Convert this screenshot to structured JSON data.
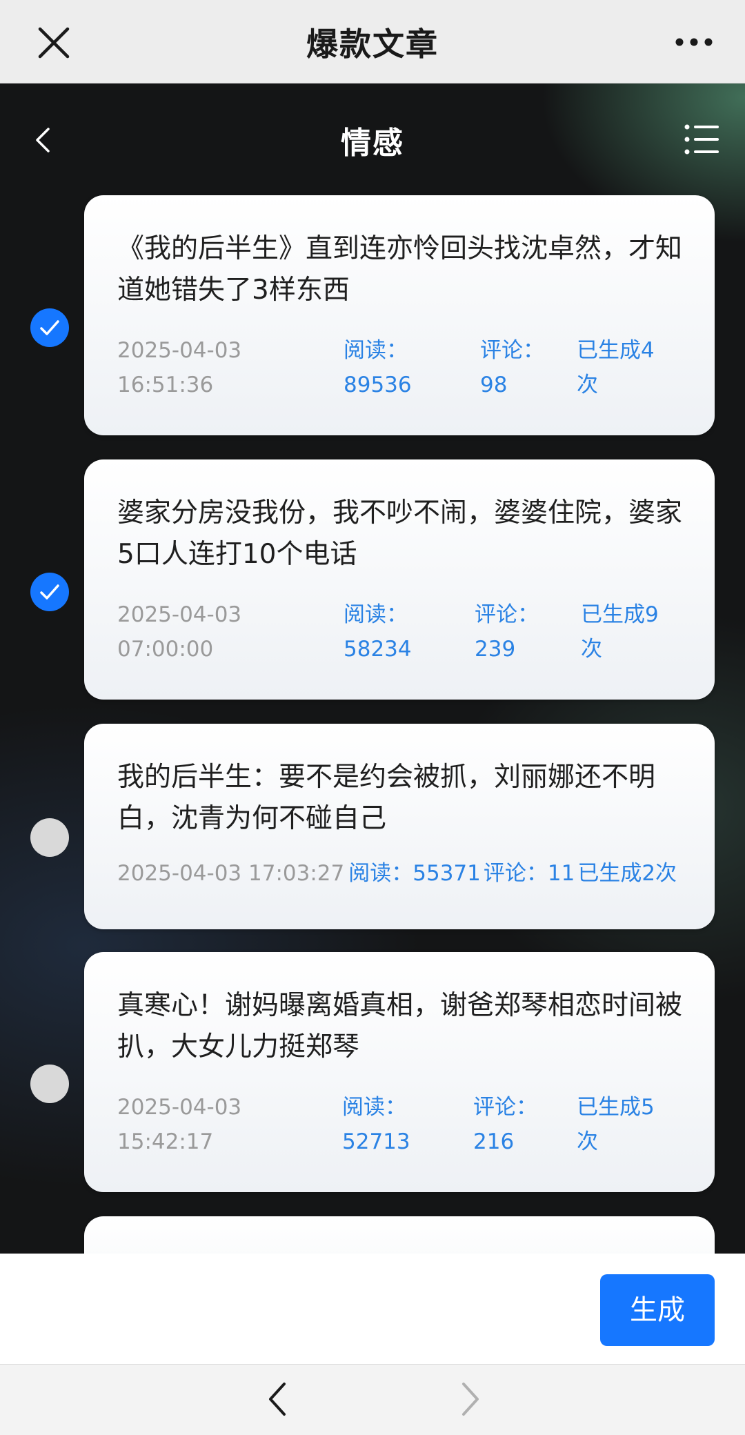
{
  "topbar": {
    "title": "爆款文章",
    "close_icon": "close-icon",
    "more_icon": "more-dots-icon"
  },
  "subheader": {
    "title": "情感",
    "back_icon": "chevron-left-icon",
    "list_icon": "list-icon"
  },
  "articles": [
    {
      "title": "《我的后半生》直到连亦怜回头找沈卓然，才知道她错失了3样东西",
      "date": "2025-04-03",
      "time": "16:51:36",
      "reads_label": "阅读：",
      "reads": "89536",
      "comments_label": "评论：",
      "comments": "98",
      "generated": "已生成4",
      "generated_unit": "次",
      "selected": true
    },
    {
      "title": "婆家分房没我份，我不吵不闹，婆婆住院，婆家5口人连打10个电话",
      "date": "2025-04-03",
      "time": "07:00:00",
      "reads_label": "阅读：",
      "reads": "58234",
      "comments_label": "评论：",
      "comments": "239",
      "generated": "已生成9",
      "generated_unit": "次",
      "selected": true
    },
    {
      "title": "我的后半生：要不是约会被抓，刘丽娜还不明白，沈青为何不碰自己",
      "datetime": "2025-04-03 17:03:27",
      "reads_text": "阅读：55371",
      "comments_text": "评论：11",
      "generated_text": "已生成2次",
      "selected": false
    },
    {
      "title": "真寒心！谢妈曝离婚真相，谢爸郑琴相恋时间被扒，大女儿力挺郑琴",
      "date": "2025-04-03",
      "time": "15:42:17",
      "reads_label": "阅读：",
      "reads": "52713",
      "comments_label": "评论：",
      "comments": "216",
      "generated": "已生成5",
      "generated_unit": "次",
      "selected": false
    }
  ],
  "actions": {
    "generate_label": "生成"
  },
  "colors": {
    "accent": "#1677ff",
    "link": "#2a82e4",
    "muted": "#9a9a9a"
  }
}
